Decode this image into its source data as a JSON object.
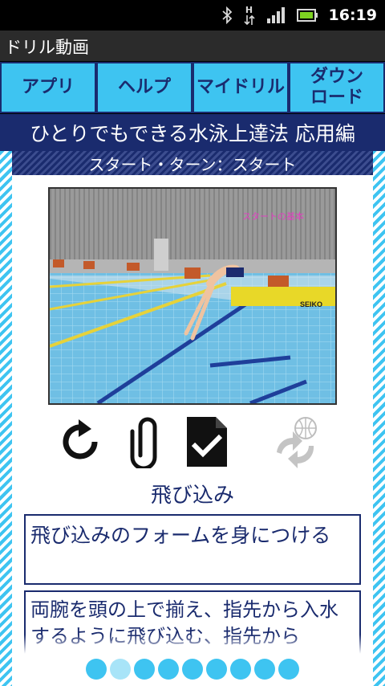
{
  "status_bar": {
    "time": "16:19",
    "icons": [
      "bluetooth-icon",
      "data-transfer-icon",
      "signal-icon",
      "battery-icon"
    ],
    "data_indicator": "H"
  },
  "app": {
    "title": "ドリル動画"
  },
  "menu": {
    "items": [
      {
        "label": "アプリ"
      },
      {
        "label": "ヘルプ"
      },
      {
        "label": "マイドリル"
      },
      {
        "label": "ダウン\nロード"
      }
    ]
  },
  "course": {
    "title": "ひとりでもできる水泳上達法 応用編"
  },
  "section": {
    "title": "スタート・ターン：スタート"
  },
  "video": {
    "overlay_text": "スタートの基本",
    "sign_text": "SEIKO"
  },
  "actions": {
    "icons": [
      "replay-icon",
      "paperclip-icon",
      "checked-document-icon",
      "share-globe-icon"
    ]
  },
  "drill": {
    "name": "飛び込み",
    "goal": "飛び込みのフォームを身につける",
    "description": "両腕を頭の上で揃え、指先から入水するように飛び込む、指先から"
  },
  "pager": {
    "count": 9,
    "active_index": 1
  },
  "colors": {
    "accent": "#3ec4f1",
    "navy": "#1a2b6e",
    "pool_water": "#7ec8e8",
    "overlay_text": "#e040c0"
  }
}
